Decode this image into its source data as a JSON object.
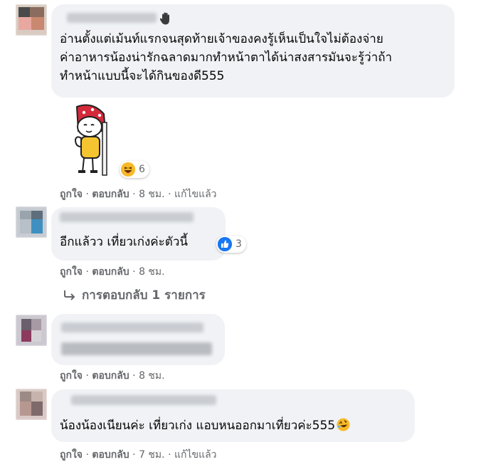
{
  "comments": [
    {
      "text_lines": [
        "อ่านตั้งแต่เม้นท์แรกจนสุดท้ายเจ้าของคงรู้เห็นเป็นใจไม่ต้องจ่าย",
        "ค่าอาหารน้องน่ารักฉลาดมากทำหน้าตาได้น่าสงสารมันจะรู้ว่าถ้า",
        "ทำหน้าแบบนี้จะได้กินของดี555"
      ],
      "reaction_count": "6",
      "actions": {
        "like": "ถูกใจ",
        "reply": "ตอบกลับ",
        "time": "8 ชม.",
        "edited": "แก้ไขแล้ว"
      }
    },
    {
      "text": "อีกแล้วว เที่ยวเก่งค่ะตัวนี้",
      "reaction_count": "3",
      "actions": {
        "like": "ถูกใจ",
        "reply": "ตอบกลับ",
        "time": "8 ชม."
      },
      "replies_link": "การตอบกลับ 1 รายการ"
    },
    {
      "actions": {
        "like": "ถูกใจ",
        "reply": "ตอบกลับ",
        "time": "8 ชม."
      }
    },
    {
      "text": "น้องน้องเนียนค่ะ เที่ยวเก่ง แอบหนออกมาเที่ยวค่ะ555",
      "actions": {
        "like": "ถูกใจ",
        "reply": "ตอบกลับ",
        "time": "7 ชม.",
        "edited": "แก้ไขแล้ว"
      }
    }
  ],
  "separator": "·",
  "icons": {
    "badge": "waving-hand-icon",
    "haha_reaction": "haha-emoji-icon",
    "like_reaction": "like-thumb-icon",
    "reply_arrow": "reply-arrow-icon",
    "sticker": "cartoon-peek-sticker",
    "inline_emoji": "rofl-emoji-icon"
  },
  "colors": {
    "bubble": "#f0f2f5",
    "meta": "#65676b",
    "like_blue": "#1877f2",
    "haha_yellow": "#f7b928"
  }
}
